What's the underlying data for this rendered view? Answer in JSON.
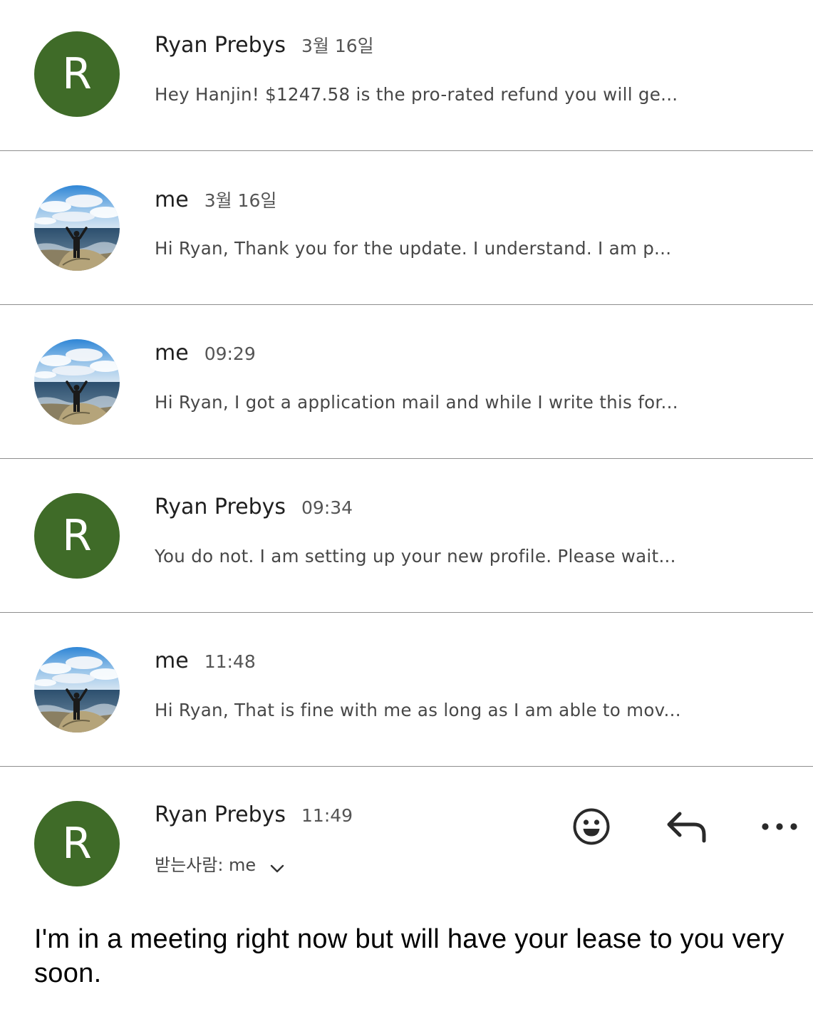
{
  "thread": {
    "messages": [
      {
        "sender": "Ryan Prebys",
        "avatar_letter": "R",
        "time": "3월 16일",
        "snippet": "Hey Hanjin! $1247.58 is the pro-rated refund you will ge..."
      },
      {
        "sender": "me",
        "time": "3월 16일",
        "snippet": "Hi Ryan, Thank you for the update. I understand. I am p..."
      },
      {
        "sender": "me",
        "time": "09:29",
        "snippet": "Hi Ryan, I got a application mail and while I write this for..."
      },
      {
        "sender": "Ryan Prebys",
        "avatar_letter": "R",
        "time": "09:34",
        "snippet": "You do not. I am setting up your new profile. Please wait..."
      },
      {
        "sender": "me",
        "time": "11:48",
        "snippet": "Hi Ryan, That is fine with me as long as I am able to mov..."
      }
    ],
    "open_message": {
      "sender": "Ryan Prebys",
      "avatar_letter": "R",
      "time": "11:49",
      "recipient": "받는사람: me",
      "body": "I'm in a meeting right now but will have your lease to you very soon."
    }
  },
  "icons": {
    "emoji": "smiley-face-icon",
    "reply": "reply-arrow-icon",
    "more": "more-horizontal-icon",
    "expand": "chevron-down-icon"
  },
  "colors": {
    "avatar_green": "#3f6b28",
    "divider": "#8e8e8e",
    "text_primary": "#1f1f1f",
    "text_secondary": "#474747"
  }
}
